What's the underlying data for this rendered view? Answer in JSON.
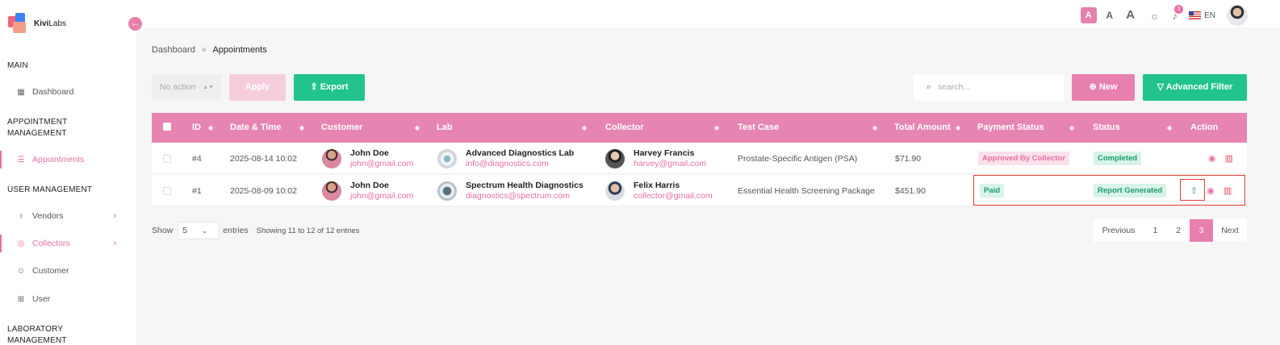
{
  "app": {
    "logo_bold": "Kivi",
    "logo_rest": "Labs",
    "collapse_icon": "←"
  },
  "sidebar": {
    "sections": {
      "main": "MAIN",
      "appointment_1": "APPOINTMENT",
      "appointment_2": "MANAGEMENT",
      "user": "USER MANAGEMENT",
      "lab_1": "LABORATORY",
      "lab_2": "MANAGEMENT"
    },
    "items": [
      {
        "label": "Dashboard",
        "icon": "▦"
      },
      {
        "label": "Appointments",
        "icon": "☰"
      },
      {
        "label": "Vendors",
        "icon": "♀"
      },
      {
        "label": "Collectors",
        "icon": "◎"
      },
      {
        "label": "Customer",
        "icon": "☺"
      },
      {
        "label": "User",
        "icon": "⊞"
      }
    ],
    "chevron": "›"
  },
  "topbar": {
    "font_small": "A",
    "font_medium": "A",
    "font_large": "A",
    "theme_icon": "☼",
    "bell_icon": "♪",
    "notification_count": "3",
    "language": "EN"
  },
  "breadcrumb": {
    "home": "Dashboard",
    "separator": "»",
    "current": "Appointments"
  },
  "toolbar": {
    "bulk_action_placeholder": "No action",
    "bulk_caret": "▲▼",
    "apply_label": "Apply",
    "export_label": "⇪ Export",
    "search_placeholder": "search...",
    "search_icon": "⌕",
    "new_label": "⊕ New",
    "filter_label": "▽ Advanced Filter"
  },
  "table": {
    "sort_icon": "◆",
    "columns": {
      "id": "ID",
      "datetime": "Date & Time",
      "customer": "Customer",
      "lab": "Lab",
      "collector": "Collector",
      "test": "Test Case",
      "amount": "Total Amount",
      "payment": "Payment Status",
      "status": "Status",
      "action": "Action"
    },
    "rows": [
      {
        "id": "#4",
        "datetime": "2025-08-14 10:02",
        "customer_name": "John Doe",
        "customer_email": "john@gmail.com",
        "lab_name": "Advanced Diagnostics Lab",
        "lab_email": "info@diagnostics.com",
        "collector_name": "Harvey Francis",
        "collector_email": "harvey@gmail.com",
        "test": "Prostate-Specific Antigen (PSA)",
        "amount": "$71.90",
        "payment": "Approved By Collector",
        "status": "Completed"
      },
      {
        "id": "#1",
        "datetime": "2025-08-09 10:02",
        "customer_name": "John Doe",
        "customer_email": "john@gmail.com",
        "lab_name": "Spectrum Health Diagnostics",
        "lab_email": "diagnostics@spectrum.com",
        "collector_name": "Felix Harris",
        "collector_email": "collector@gmail.com",
        "test": "Essential Health Screening Package",
        "amount": "$451.90",
        "payment": "Paid",
        "status": "Report Generated"
      }
    ],
    "action_icons": {
      "view": "◉",
      "delete": "▥",
      "upload": "⇧"
    }
  },
  "footer": {
    "show_label": "Show",
    "page_size": "5",
    "caret": "⌄",
    "entries_label": "entries",
    "info": "Showing 11 to 12 of 12 entries",
    "pagination": {
      "previous": "Previous",
      "pages": [
        "1",
        "2",
        "3"
      ],
      "current": "3",
      "next": "Next"
    }
  },
  "colors": {
    "accent_pink": "#e880ad",
    "accent_green": "#22c38e",
    "highlight_red": "#e53935"
  }
}
